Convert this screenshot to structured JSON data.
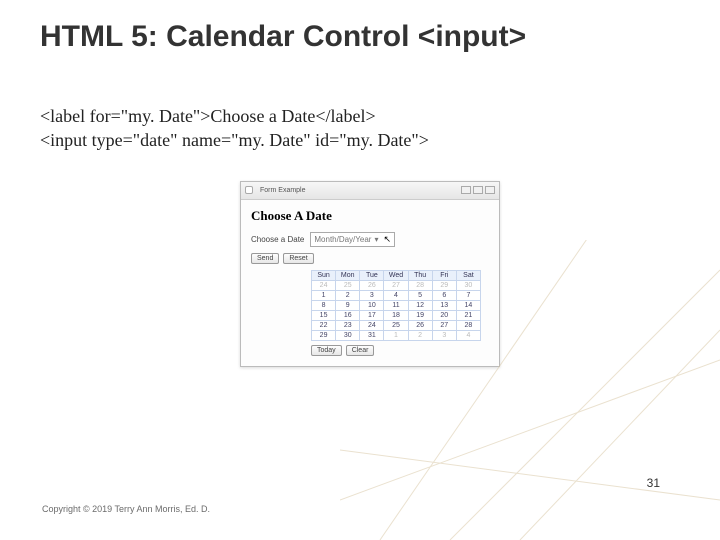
{
  "title": "HTML 5: Calendar Control <input>",
  "code": {
    "line1": "<label for=\"my. Date\">Choose a Date</label>",
    "line2": " <input type=\"date\" name=\"my. Date\" id=\"my. Date\">"
  },
  "screenshot": {
    "tab_label": "Form Example",
    "heading": "Choose A Date",
    "form_label": "Choose a Date",
    "date_placeholder": "Month/Day/Year",
    "submit_label": "Send",
    "reset_label": "Reset",
    "today_label": "Today",
    "clear_label": "Clear",
    "days": [
      "Sun",
      "Mon",
      "Tue",
      "Wed",
      "Thu",
      "Fri",
      "Sat"
    ],
    "rows": [
      [
        "24",
        "25",
        "26",
        "27",
        "28",
        "29",
        "30"
      ],
      [
        "1",
        "2",
        "3",
        "4",
        "5",
        "6",
        "7"
      ],
      [
        "8",
        "9",
        "10",
        "11",
        "12",
        "13",
        "14"
      ],
      [
        "15",
        "16",
        "17",
        "18",
        "19",
        "20",
        "21"
      ],
      [
        "22",
        "23",
        "24",
        "25",
        "26",
        "27",
        "28"
      ],
      [
        "29",
        "30",
        "31",
        "1",
        "2",
        "3",
        "4"
      ]
    ]
  },
  "page_number": "31",
  "copyright": "Copyright © 2019 Terry Ann Morris, Ed. D."
}
